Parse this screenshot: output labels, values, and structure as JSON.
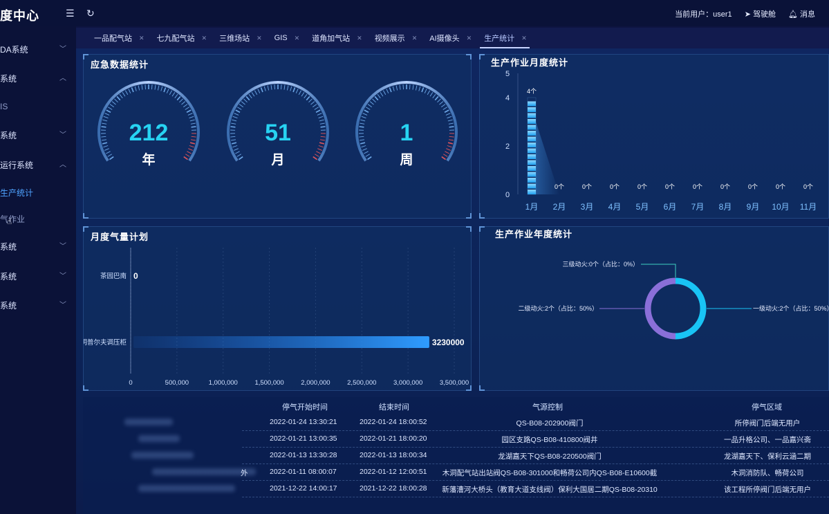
{
  "app": {
    "brand": "度中心",
    "menu_icon": "hamburger-icon",
    "refresh_icon": "refresh-icon"
  },
  "topbar": {
    "user_label": "当前用户：",
    "user_name": "user1",
    "cockpit_label": "驾驶舱",
    "cockpit_icon": "send-icon",
    "messages_label": "消息",
    "messages_icon": "bell-icon"
  },
  "sidebar": {
    "items": [
      {
        "label": "DA系统",
        "chevron": "down"
      },
      {
        "label": "系统",
        "chevron": "up"
      },
      {
        "label": "IS",
        "chevron": ""
      },
      {
        "label": "系统",
        "chevron": "down"
      },
      {
        "label": "运行系统",
        "chevron": "up"
      },
      {
        "label": "生产统计",
        "chevron": ""
      },
      {
        "label": "气作业",
        "chevron": ""
      },
      {
        "label": "系统",
        "chevron": "down"
      },
      {
        "label": "系统",
        "chevron": "down"
      },
      {
        "label": "系统",
        "chevron": "down"
      }
    ]
  },
  "tabs": [
    {
      "label": "一品配气站"
    },
    {
      "label": "七九配气站"
    },
    {
      "label": "三维场站"
    },
    {
      "label": "GIS"
    },
    {
      "label": "道角加气站"
    },
    {
      "label": "视频展示"
    },
    {
      "label": "AI摄像头"
    },
    {
      "label": "生产统计",
      "active": true
    }
  ],
  "emergency": {
    "title": "应急数据统计",
    "gauges": [
      {
        "value": "212",
        "unit": "年"
      },
      {
        "value": "51",
        "unit": "月"
      },
      {
        "value": "1",
        "unit": "周"
      }
    ]
  },
  "monthly_production": {
    "title": "生产作业月度统计",
    "chart_data": {
      "type": "bar",
      "categories": [
        "1月",
        "2月",
        "3月",
        "4月",
        "5月",
        "6月",
        "7月",
        "8月",
        "9月",
        "10月",
        "11月"
      ],
      "values": [
        4,
        0,
        0,
        0,
        0,
        0,
        0,
        0,
        0,
        0,
        0
      ],
      "data_labels": [
        "4个",
        "0个",
        "0个",
        "0个",
        "0个",
        "0个",
        "0个",
        "0个",
        "0个",
        "0个",
        "0个"
      ],
      "yticks": [
        "5",
        "4",
        "2",
        "0"
      ],
      "ylim": [
        0,
        5
      ]
    }
  },
  "monthly_gas_plan": {
    "title": "月度气量计划",
    "chart_data": {
      "type": "bar",
      "orientation": "horizontal",
      "categories": [
        "茶园巴南",
        "昆明普尔夫调压柜"
      ],
      "values": [
        0,
        3230000
      ],
      "data_labels": [
        "0",
        "3230000"
      ],
      "xticks": [
        "0",
        "500,000",
        "1,000,000",
        "1,500,000",
        "2,000,000",
        "2,500,000",
        "3,000,000",
        "3,500,000"
      ],
      "xlim": [
        0,
        3500000
      ]
    }
  },
  "annual_production": {
    "title": "生产作业年度统计",
    "chart_data": {
      "type": "pie",
      "donut": true,
      "slices": [
        {
          "label": "一级动火:2个（占比：50%）",
          "value": 2,
          "color": "#19c4f5"
        },
        {
          "label": "二级动火:2个（占比：50%）",
          "value": 2,
          "color": "#8a6fd8"
        },
        {
          "label": "三级动火:0个（占比：0%）",
          "value": 0,
          "color": "#3fd0c0"
        }
      ]
    }
  },
  "table": {
    "headers": [
      "停气开始时间",
      "结束时间",
      "气源控制",
      "停气区域"
    ],
    "rows": [
      {
        "prefix": "",
        "start": "2022-01-24 13:30:21",
        "end": "2022-01-24 18:00:52",
        "control": "QS-B08-202900阀门",
        "area": "所停阀门后端无用户"
      },
      {
        "prefix": "",
        "start": "2022-01-21 13:00:35",
        "end": "2022-01-21 18:00:20",
        "control": "园区支路QS-B08-410800阀井",
        "area": "一品升格公司、一品嘉兴斋"
      },
      {
        "prefix": "",
        "start": "2022-01-13 13:30:28",
        "end": "2022-01-13 18:00:34",
        "control": "龙湖嘉天下QS-B08-220500阀门",
        "area": "龙湖嘉天下、保利云涵二期"
      },
      {
        "prefix": "外",
        "start": "2022-01-11 08:00:07",
        "end": "2022-01-12 12:00:51",
        "control": "木洞配气站出站阀QS-B08-301000和畅荷公司内QS-B08-E10600截",
        "area": "木洞消防队、畅荷公司"
      },
      {
        "prefix": "",
        "start": "2021-12-22 14:00:17",
        "end": "2021-12-22 18:00:28",
        "control": "新藩漕河大桥头（教育大道支线阀）保利大国居二期QS-B08-20310",
        "area": "该工程所停阀门后端无用户"
      }
    ]
  }
}
